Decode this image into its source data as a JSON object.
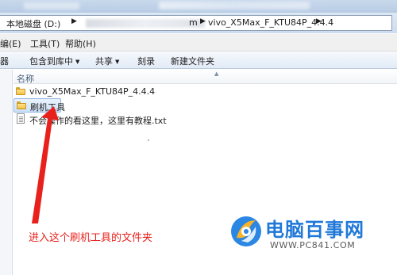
{
  "address_bar": {
    "crumbs": [
      "本地磁盘 (D:)",
      "m",
      "vivo_X5Max_F_KTU84P_4.4.4"
    ]
  },
  "menu": {
    "items": [
      "编(E)",
      "工具(T)",
      "帮助(H)"
    ]
  },
  "toolbar": {
    "items": [
      "器",
      "包含到库中",
      "共享",
      "刻录",
      "新建文件夹"
    ]
  },
  "file_list": {
    "column_header": "名称",
    "items": [
      {
        "name": "vivo_X5Max_F_KTU84P_4.4.4",
        "icon": "folder-icon"
      },
      {
        "name": "刷机工具",
        "icon": "folder-icon"
      },
      {
        "name": "不会操作的看这里，这里有教程.txt",
        "icon": "text-file-icon"
      }
    ]
  },
  "annotation": {
    "text": "进入这个刷机工具的文件夹",
    "color": "#e8211c"
  },
  "watermark": {
    "title": "电脑百事网",
    "url": "WWW.PC841.COM",
    "color": "#1f78d8"
  }
}
